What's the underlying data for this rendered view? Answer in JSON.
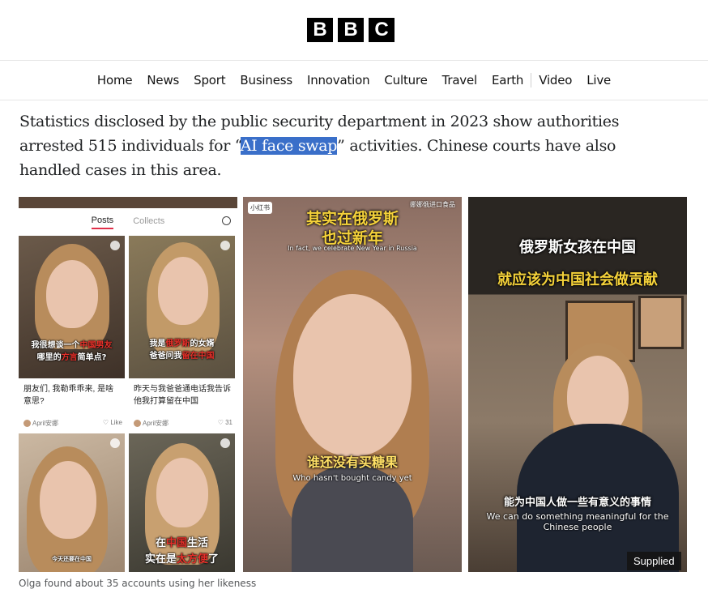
{
  "logo": [
    "B",
    "B",
    "C"
  ],
  "nav": [
    "Home",
    "News",
    "Sport",
    "Business",
    "Innovation",
    "Culture",
    "Travel",
    "Earth",
    "Video",
    "Live"
  ],
  "article": {
    "before": "Statistics disclosed by the public security department in 2023 show authorities arrested 515 individuals for “",
    "highlight": "AI face swap",
    "after": "” activities. Chinese courts have also handled cases in this area."
  },
  "panel1": {
    "tabs": [
      "Posts",
      "Collects"
    ],
    "search_icon": "search-icon",
    "cards": [
      {
        "cap1": "我很想谈一个",
        "cap1_red": "中国男友",
        "cap2": "哪里的",
        "cap2_red": "方言",
        "cap2_end": "简单点?",
        "text": "朋友们, 我勒乖乖来, 是啥意思?",
        "author": "April安娜",
        "stat": "Like"
      },
      {
        "cap1": "我是",
        "cap1_red": "俄罗斯",
        "cap1_end": "的女婿",
        "cap2": "爸爸问我",
        "cap2_red": "留在中国",
        "text": "昨天与我爸爸通电话我告诉他我打算留在中国",
        "author": "April安娜",
        "stat": "31"
      },
      {
        "cap1": "今天还要在中国"
      },
      {
        "cap1": "在",
        "cap1_red": "中国",
        "cap1_end": "生活",
        "cap2": "实在是",
        "cap2_red": "太方便",
        "cap2_end": "了"
      }
    ]
  },
  "panel2": {
    "badge": "小红书",
    "top_right": "娜娜俄进口食品",
    "title1": "其实在俄罗斯",
    "title2": "也过新年",
    "title_en": "In fact, we celebrate New Year in Russia",
    "sub_zh": "谁还没有买糖果",
    "sub_en": "Who hasn't bought candy yet"
  },
  "panel3": {
    "title1": "俄罗斯女孩在中国",
    "title2": "就应该为中国社会做贡献",
    "sub_zh": "能为中国人做一些有意义的事情",
    "sub_en": "We can do something meaningful for the Chinese people"
  },
  "supplied": "Supplied",
  "caption": "Olga found about 35 accounts using her likeness"
}
